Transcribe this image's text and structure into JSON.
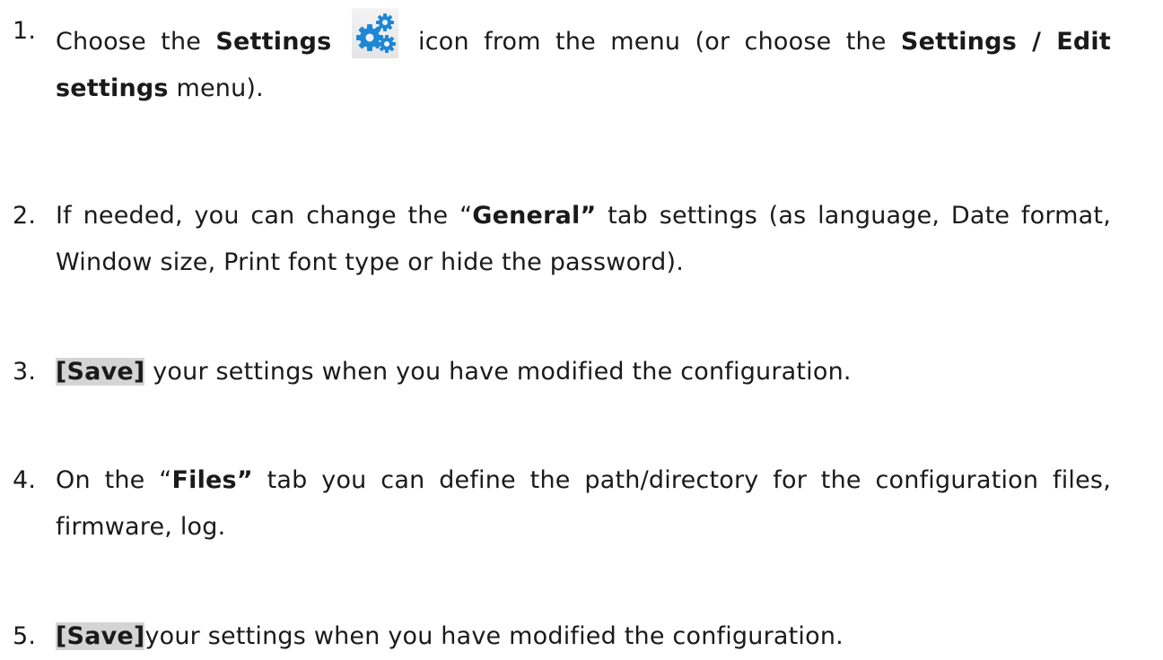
{
  "steps": [
    {
      "number": "1.",
      "a_bold": "Settings",
      "b": " icon from the menu (or choose the ",
      "c_bold": "Settings / Edit settings",
      "d": " menu).",
      "prefix": "Choose the ",
      "icon": "settings-gears-icon"
    },
    {
      "number": "2.",
      "prefix": "If needed, you can change the “",
      "bold": "General”",
      "suffix": " tab settings (as language, Date format, Window size, Print font type or hide the password)."
    },
    {
      "number": "3.",
      "button": "[Save]",
      "suffix": " your settings when you have modified the configuration."
    },
    {
      "number": "4.",
      "prefix": "On the “",
      "bold": "Files”",
      "suffix": " tab you can define the path/directory for the configuration files, firmware, log."
    },
    {
      "number": "5.",
      "button": "[Save]",
      "suffix": "your settings when you have modified the configuration."
    }
  ],
  "colors": {
    "gear": "#1e86d6",
    "highlight": "#d4d4d4"
  }
}
